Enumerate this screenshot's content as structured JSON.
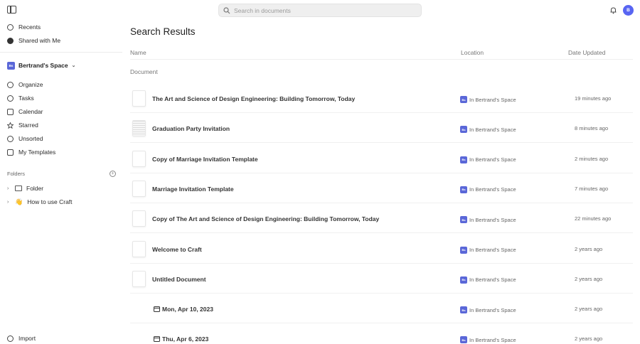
{
  "topbar": {
    "search_placeholder": "Search in documents",
    "avatar_initial": "B"
  },
  "sidebar": {
    "top_items": [
      {
        "label": "Recents",
        "icon": "clock-icon"
      },
      {
        "label": "Shared with Me",
        "icon": "shared-icon"
      }
    ],
    "space": {
      "badge": "Bs",
      "name": "Bertrand's Space"
    },
    "items": [
      {
        "label": "Organize",
        "icon": "organize-icon"
      },
      {
        "label": "Tasks",
        "icon": "check-circle-icon"
      },
      {
        "label": "Calendar",
        "icon": "calendar-icon"
      },
      {
        "label": "Starred",
        "icon": "star-icon"
      },
      {
        "label": "Unsorted",
        "icon": "unsorted-icon"
      },
      {
        "label": "My Templates",
        "icon": "templates-icon"
      }
    ],
    "folders_label": "Folders",
    "folders": [
      {
        "label": "Folder",
        "icon": "folder-icon"
      },
      {
        "label": "How to use Craft",
        "icon": "waving-hand-icon",
        "emoji": "👋"
      }
    ],
    "import_label": "Import"
  },
  "main": {
    "title": "Search Results",
    "columns": {
      "name": "Name",
      "location": "Location",
      "date": "Date Updated"
    },
    "section_label": "Document",
    "rows": [
      {
        "title": "The Art and Science of Design Engineering: Building Tomorrow, Today",
        "location": "In Bertrand's Space",
        "date": "19 minutes ago",
        "icon": ""
      },
      {
        "title": "Graduation Party Invitation",
        "location": "In Bertrand's Space",
        "date": "8 minutes ago",
        "icon": ""
      },
      {
        "title": "Copy of Marriage Invitation Template",
        "location": "In Bertrand's Space",
        "date": "2 minutes ago",
        "icon": ""
      },
      {
        "title": "Marriage Invitation Template",
        "location": "In Bertrand's Space",
        "date": "7 minutes ago",
        "icon": ""
      },
      {
        "title": "Copy of The Art and Science of Design Engineering: Building Tomorrow, Today",
        "location": "In Bertrand's Space",
        "date": "22 minutes ago",
        "icon": ""
      },
      {
        "title": "Welcome to Craft",
        "location": "In Bertrand's Space",
        "date": "2 years ago",
        "icon": ""
      },
      {
        "title": "Untitled Document",
        "location": "In Bertrand's Space",
        "date": "2 years ago",
        "icon": ""
      },
      {
        "title": "Mon, Apr 10, 2023",
        "location": "In Bertrand's Space",
        "date": "2 years ago",
        "icon": "calendar-icon"
      },
      {
        "title": "Thu, Apr 6, 2023",
        "location": "In Bertrand's Space",
        "date": "2 years ago",
        "icon": "calendar-icon"
      }
    ]
  },
  "colors": {
    "accent": "#5a67d8",
    "avatar": "#5865f2"
  }
}
